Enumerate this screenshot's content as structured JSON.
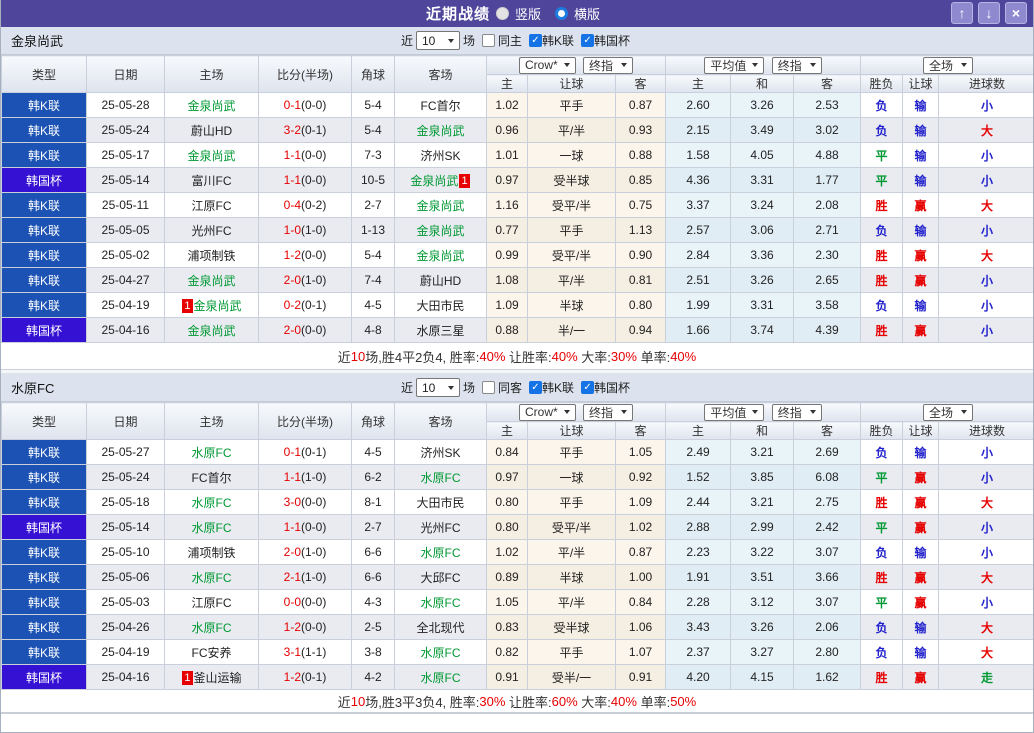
{
  "title_bar": {
    "title": "近期战绩",
    "radio_vertical": "竖版",
    "radio_horizontal": "横版",
    "buttons": {
      "up": "↑",
      "down": "↓",
      "close": "×"
    }
  },
  "columns": {
    "type": "类型",
    "date": "日期",
    "home": "主场",
    "score": "比分(半场)",
    "corner": "角球",
    "away": "客场",
    "odds_home": "主",
    "odds_handicap": "让球",
    "odds_away": "客",
    "avg_home": "主",
    "avg_draw": "和",
    "avg_away": "客",
    "result_wdl": "胜负",
    "result_handicap": "让球",
    "result_goals": "进球数"
  },
  "dropdowns": {
    "crow": "Crow*",
    "final": "终指",
    "average": "平均值",
    "full": "全场"
  },
  "controls_labels": {
    "near": "近",
    "games": "场"
  },
  "colors": {
    "title_bar": "#4f459b",
    "league_k": "#1b52b4",
    "league_cup": "#3511d3",
    "team_green": "#009933",
    "score_red": "#e60000",
    "result_red": "#e60000",
    "result_blue": "#2222cc",
    "result_green": "#009933",
    "odds_bg": "#fcf5eb",
    "avg_bg": "#e9f4f9"
  },
  "sections": [
    {
      "team": "金泉尚武",
      "controls": {
        "games_count": "10",
        "same_label": "同主",
        "same_checked": false,
        "leagues": [
          {
            "label": "韩K联",
            "checked": true
          },
          {
            "label": "韩国杯",
            "checked": true
          }
        ]
      },
      "rows": [
        {
          "lg": "韩K联",
          "cup": false,
          "date": "25-05-28",
          "home": "金泉尚武",
          "hg": true,
          "hb": null,
          "score": "0-1",
          "half": "(0-0)",
          "corner": "5-4",
          "away": "FC首尔",
          "ag": false,
          "ab": null,
          "odds": [
            "1.02",
            "平手",
            "0.87"
          ],
          "avg": [
            "2.60",
            "3.26",
            "2.53"
          ],
          "res": [
            "负",
            "输",
            "小"
          ]
        },
        {
          "lg": "韩K联",
          "cup": false,
          "date": "25-05-24",
          "home": "蔚山HD",
          "hg": false,
          "hb": null,
          "score": "3-2",
          "half": "(0-1)",
          "corner": "5-4",
          "away": "金泉尚武",
          "ag": true,
          "ab": null,
          "odds": [
            "0.96",
            "平/半",
            "0.93"
          ],
          "avg": [
            "2.15",
            "3.49",
            "3.02"
          ],
          "res": [
            "负",
            "输",
            "大"
          ]
        },
        {
          "lg": "韩K联",
          "cup": false,
          "date": "25-05-17",
          "home": "金泉尚武",
          "hg": true,
          "hb": null,
          "score": "1-1",
          "half": "(0-0)",
          "corner": "7-3",
          "away": "济州SK",
          "ag": false,
          "ab": null,
          "odds": [
            "1.01",
            "一球",
            "0.88"
          ],
          "avg": [
            "1.58",
            "4.05",
            "4.88"
          ],
          "res": [
            "平",
            "输",
            "小"
          ]
        },
        {
          "lg": "韩国杯",
          "cup": true,
          "date": "25-05-14",
          "home": "富川FC",
          "hg": false,
          "hb": null,
          "score": "1-1",
          "half": "(0-0)",
          "corner": "10-5",
          "away": "金泉尚武",
          "ag": true,
          "ab": "1",
          "odds": [
            "0.97",
            "受半球",
            "0.85"
          ],
          "avg": [
            "4.36",
            "3.31",
            "1.77"
          ],
          "res": [
            "平",
            "输",
            "小"
          ]
        },
        {
          "lg": "韩K联",
          "cup": false,
          "date": "25-05-11",
          "home": "江原FC",
          "hg": false,
          "hb": null,
          "score": "0-4",
          "half": "(0-2)",
          "corner": "2-7",
          "away": "金泉尚武",
          "ag": true,
          "ab": null,
          "odds": [
            "1.16",
            "受平/半",
            "0.75"
          ],
          "avg": [
            "3.37",
            "3.24",
            "2.08"
          ],
          "res": [
            "胜",
            "赢",
            "大"
          ]
        },
        {
          "lg": "韩K联",
          "cup": false,
          "date": "25-05-05",
          "home": "光州FC",
          "hg": false,
          "hb": null,
          "score": "1-0",
          "half": "(1-0)",
          "corner": "1-13",
          "away": "金泉尚武",
          "ag": true,
          "ab": null,
          "odds": [
            "0.77",
            "平手",
            "1.13"
          ],
          "avg": [
            "2.57",
            "3.06",
            "2.71"
          ],
          "res": [
            "负",
            "输",
            "小"
          ]
        },
        {
          "lg": "韩K联",
          "cup": false,
          "date": "25-05-02",
          "home": "浦项制铁",
          "hg": false,
          "hb": null,
          "score": "1-2",
          "half": "(0-0)",
          "corner": "5-4",
          "away": "金泉尚武",
          "ag": true,
          "ab": null,
          "odds": [
            "0.99",
            "受平/半",
            "0.90"
          ],
          "avg": [
            "2.84",
            "3.36",
            "2.30"
          ],
          "res": [
            "胜",
            "赢",
            "大"
          ]
        },
        {
          "lg": "韩K联",
          "cup": false,
          "date": "25-04-27",
          "home": "金泉尚武",
          "hg": true,
          "hb": null,
          "score": "2-0",
          "half": "(1-0)",
          "corner": "7-4",
          "away": "蔚山HD",
          "ag": false,
          "ab": null,
          "odds": [
            "1.08",
            "平/半",
            "0.81"
          ],
          "avg": [
            "2.51",
            "3.26",
            "2.65"
          ],
          "res": [
            "胜",
            "赢",
            "小"
          ]
        },
        {
          "lg": "韩K联",
          "cup": false,
          "date": "25-04-19",
          "home": "金泉尚武",
          "hg": true,
          "hb": "1",
          "score": "0-2",
          "half": "(0-1)",
          "corner": "4-5",
          "away": "大田市民",
          "ag": false,
          "ab": null,
          "odds": [
            "1.09",
            "半球",
            "0.80"
          ],
          "avg": [
            "1.99",
            "3.31",
            "3.58"
          ],
          "res": [
            "负",
            "输",
            "小"
          ]
        },
        {
          "lg": "韩国杯",
          "cup": true,
          "date": "25-04-16",
          "home": "金泉尚武",
          "hg": true,
          "hb": null,
          "score": "2-0",
          "half": "(0-0)",
          "corner": "4-8",
          "away": "水原三星",
          "ag": false,
          "ab": null,
          "odds": [
            "0.88",
            "半/一",
            "0.94"
          ],
          "avg": [
            "1.66",
            "3.74",
            "4.39"
          ],
          "res": [
            "胜",
            "赢",
            "小"
          ]
        }
      ],
      "summary": [
        [
          "近",
          "k"
        ],
        [
          "10",
          "r"
        ],
        [
          "场,胜4平2负4, 胜率:",
          "k"
        ],
        [
          "40%",
          "r"
        ],
        [
          " 让胜率:",
          "k"
        ],
        [
          "40%",
          "r"
        ],
        [
          " 大率:",
          "k"
        ],
        [
          "30%",
          "r"
        ],
        [
          " 单率:",
          "k"
        ],
        [
          "40%",
          "r"
        ]
      ]
    },
    {
      "team": "水原FC",
      "controls": {
        "games_count": "10",
        "same_label": "同客",
        "same_checked": false,
        "leagues": [
          {
            "label": "韩K联",
            "checked": true
          },
          {
            "label": "韩国杯",
            "checked": true
          }
        ]
      },
      "rows": [
        {
          "lg": "韩K联",
          "cup": false,
          "date": "25-05-27",
          "home": "水原FC",
          "hg": true,
          "hb": null,
          "score": "0-1",
          "half": "(0-1)",
          "corner": "4-5",
          "away": "济州SK",
          "ag": false,
          "ab": null,
          "odds": [
            "0.84",
            "平手",
            "1.05"
          ],
          "avg": [
            "2.49",
            "3.21",
            "2.69"
          ],
          "res": [
            "负",
            "输",
            "小"
          ]
        },
        {
          "lg": "韩K联",
          "cup": false,
          "date": "25-05-24",
          "home": "FC首尔",
          "hg": false,
          "hb": null,
          "score": "1-1",
          "half": "(1-0)",
          "corner": "6-2",
          "away": "水原FC",
          "ag": true,
          "ab": null,
          "odds": [
            "0.97",
            "一球",
            "0.92"
          ],
          "avg": [
            "1.52",
            "3.85",
            "6.08"
          ],
          "res": [
            "平",
            "赢",
            "小"
          ]
        },
        {
          "lg": "韩K联",
          "cup": false,
          "date": "25-05-18",
          "home": "水原FC",
          "hg": true,
          "hb": null,
          "score": "3-0",
          "half": "(0-0)",
          "corner": "8-1",
          "away": "大田市民",
          "ag": false,
          "ab": null,
          "odds": [
            "0.80",
            "平手",
            "1.09"
          ],
          "avg": [
            "2.44",
            "3.21",
            "2.75"
          ],
          "res": [
            "胜",
            "赢",
            "大"
          ]
        },
        {
          "lg": "韩国杯",
          "cup": true,
          "date": "25-05-14",
          "home": "水原FC",
          "hg": true,
          "hb": null,
          "score": "1-1",
          "half": "(0-0)",
          "corner": "2-7",
          "away": "光州FC",
          "ag": false,
          "ab": null,
          "odds": [
            "0.80",
            "受平/半",
            "1.02"
          ],
          "avg": [
            "2.88",
            "2.99",
            "2.42"
          ],
          "res": [
            "平",
            "赢",
            "小"
          ]
        },
        {
          "lg": "韩K联",
          "cup": false,
          "date": "25-05-10",
          "home": "浦项制铁",
          "hg": false,
          "hb": null,
          "score": "2-0",
          "half": "(1-0)",
          "corner": "6-6",
          "away": "水原FC",
          "ag": true,
          "ab": null,
          "odds": [
            "1.02",
            "平/半",
            "0.87"
          ],
          "avg": [
            "2.23",
            "3.22",
            "3.07"
          ],
          "res": [
            "负",
            "输",
            "小"
          ]
        },
        {
          "lg": "韩K联",
          "cup": false,
          "date": "25-05-06",
          "home": "水原FC",
          "hg": true,
          "hb": null,
          "score": "2-1",
          "half": "(1-0)",
          "corner": "6-6",
          "away": "大邱FC",
          "ag": false,
          "ab": null,
          "odds": [
            "0.89",
            "半球",
            "1.00"
          ],
          "avg": [
            "1.91",
            "3.51",
            "3.66"
          ],
          "res": [
            "胜",
            "赢",
            "大"
          ]
        },
        {
          "lg": "韩K联",
          "cup": false,
          "date": "25-05-03",
          "home": "江原FC",
          "hg": false,
          "hb": null,
          "score": "0-0",
          "half": "(0-0)",
          "corner": "4-3",
          "away": "水原FC",
          "ag": true,
          "ab": null,
          "odds": [
            "1.05",
            "平/半",
            "0.84"
          ],
          "avg": [
            "2.28",
            "3.12",
            "3.07"
          ],
          "res": [
            "平",
            "赢",
            "小"
          ]
        },
        {
          "lg": "韩K联",
          "cup": false,
          "date": "25-04-26",
          "home": "水原FC",
          "hg": true,
          "hb": null,
          "score": "1-2",
          "half": "(0-0)",
          "corner": "2-5",
          "away": "全北现代",
          "ag": false,
          "ab": null,
          "odds": [
            "0.83",
            "受半球",
            "1.06"
          ],
          "avg": [
            "3.43",
            "3.26",
            "2.06"
          ],
          "res": [
            "负",
            "输",
            "大"
          ]
        },
        {
          "lg": "韩K联",
          "cup": false,
          "date": "25-04-19",
          "home": "FC安养",
          "hg": false,
          "hb": null,
          "score": "3-1",
          "half": "(1-1)",
          "corner": "3-8",
          "away": "水原FC",
          "ag": true,
          "ab": null,
          "odds": [
            "0.82",
            "平手",
            "1.07"
          ],
          "avg": [
            "2.37",
            "3.27",
            "2.80"
          ],
          "res": [
            "负",
            "输",
            "大"
          ]
        },
        {
          "lg": "韩国杯",
          "cup": true,
          "date": "25-04-16",
          "home": "釜山运输",
          "hg": false,
          "hb": "1",
          "score": "1-2",
          "half": "(0-1)",
          "corner": "4-2",
          "away": "水原FC",
          "ag": true,
          "ab": null,
          "odds": [
            "0.91",
            "受半/一",
            "0.91"
          ],
          "avg": [
            "4.20",
            "4.15",
            "1.62"
          ],
          "res": [
            "胜",
            "赢",
            "走"
          ]
        }
      ],
      "summary": [
        [
          "近",
          "k"
        ],
        [
          "10",
          "r"
        ],
        [
          "场,胜3平3负4, 胜率:",
          "k"
        ],
        [
          "30%",
          "r"
        ],
        [
          " 让胜率:",
          "k"
        ],
        [
          "60%",
          "r"
        ],
        [
          " 大率:",
          "k"
        ],
        [
          "40%",
          "r"
        ],
        [
          " 单率:",
          "k"
        ],
        [
          "50%",
          "r"
        ]
      ]
    }
  ]
}
